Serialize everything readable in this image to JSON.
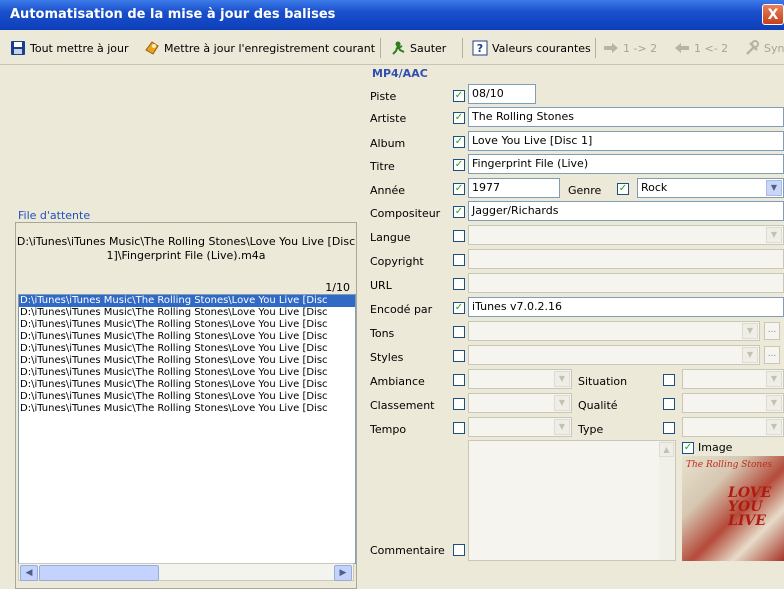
{
  "window": {
    "title": "Automatisation de la mise à jour des balises",
    "close_label": "X"
  },
  "toolbar": {
    "update_all": "Tout mettre à jour",
    "update_current": "Mettre à jour l'enregistrement courant",
    "skip": "Sauter",
    "current_values": "Valeurs courantes",
    "copy_1_to_2": "1 -> 2",
    "copy_1_from_2": "1 <- 2",
    "sync": "Syn"
  },
  "queue": {
    "label": "File d'attente",
    "current_path": "D:\\iTunes\\iTunes Music\\The Rolling Stones\\Love You Live [Disc 1]\\Fingerprint File (Live).m4a",
    "counter": "1/10",
    "items": [
      "D:\\iTunes\\iTunes Music\\The Rolling Stones\\Love You Live [Disc",
      "D:\\iTunes\\iTunes Music\\The Rolling Stones\\Love You Live [Disc",
      "D:\\iTunes\\iTunes Music\\The Rolling Stones\\Love You Live [Disc",
      "D:\\iTunes\\iTunes Music\\The Rolling Stones\\Love You Live [Disc",
      "D:\\iTunes\\iTunes Music\\The Rolling Stones\\Love You Live [Disc",
      "D:\\iTunes\\iTunes Music\\The Rolling Stones\\Love You Live [Disc",
      "D:\\iTunes\\iTunes Music\\The Rolling Stones\\Love You Live [Disc",
      "D:\\iTunes\\iTunes Music\\The Rolling Stones\\Love You Live [Disc",
      "D:\\iTunes\\iTunes Music\\The Rolling Stones\\Love You Live [Disc",
      "D:\\iTunes\\iTunes Music\\The Rolling Stones\\Love You Live [Disc"
    ]
  },
  "tags": {
    "section": "MP4/AAC",
    "piste": {
      "label": "Piste",
      "value": "08/10",
      "checked": true
    },
    "artiste": {
      "label": "Artiste",
      "value": "The Rolling Stones",
      "checked": true
    },
    "album": {
      "label": "Album",
      "value": "Love You Live [Disc 1]",
      "checked": true
    },
    "titre": {
      "label": "Titre",
      "value": "Fingerprint File (Live)",
      "checked": true
    },
    "annee": {
      "label": "Année",
      "value": "1977",
      "checked": true
    },
    "genre": {
      "label": "Genre",
      "value": "Rock",
      "checked": true
    },
    "compositeur": {
      "label": "Compositeur",
      "value": "Jagger/Richards",
      "checked": true
    },
    "langue": {
      "label": "Langue",
      "value": "",
      "checked": false
    },
    "copyright": {
      "label": "Copyright",
      "value": "",
      "checked": false
    },
    "url": {
      "label": "URL",
      "value": "",
      "checked": false
    },
    "encode_par": {
      "label": "Encodé par",
      "value": "iTunes v7.0.2.16",
      "checked": true
    },
    "tons": {
      "label": "Tons",
      "value": "",
      "checked": false
    },
    "styles": {
      "label": "Styles",
      "value": "",
      "checked": false
    },
    "ambiance": {
      "label": "Ambiance",
      "value": "",
      "checked": false
    },
    "situation": {
      "label": "Situation",
      "value": "",
      "checked": false
    },
    "classement": {
      "label": "Classement",
      "value": "",
      "checked": false
    },
    "qualite": {
      "label": "Qualité",
      "value": "",
      "checked": false
    },
    "tempo": {
      "label": "Tempo",
      "value": "",
      "checked": false
    },
    "type": {
      "label": "Type",
      "value": "",
      "checked": false
    },
    "image": {
      "label": "Image",
      "checked": true
    },
    "commentaire": {
      "label": "Commentaire",
      "value": "",
      "checked": false
    }
  },
  "cover": {
    "band_text": "The Rolling Stones",
    "album_text": "LOVE YOU LIVE"
  },
  "colors": {
    "titlebar": "#1a4fcc",
    "selection": "#316ac5",
    "section": "#3050b0",
    "check": "#21a121"
  }
}
